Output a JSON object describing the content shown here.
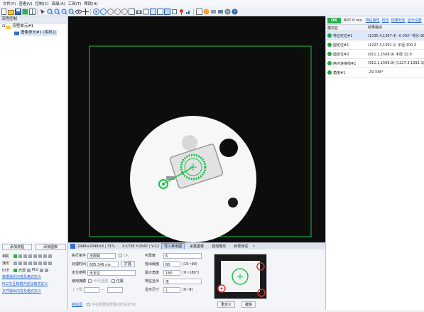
{
  "menu": [
    "文件(F)",
    "查看(V)",
    "控制(C)",
    "高级(A)",
    "工具(T)",
    "帮助(H)"
  ],
  "tree": {
    "title": "流程控制",
    "node": "流程单元#1",
    "child": "图像单元#1 (相机1)"
  },
  "left_bottom": {
    "add_flow": "添加流程",
    "add_image": "添加图像",
    "camera": "相机",
    "comm": "通讯",
    "io": "IO卡",
    "light": "光源",
    "plc": "PLC",
    "links": [
      "数据通讯内容及格式定义",
      "PLC交互数据内容及格式定义",
      "文件输出内容及格式定义"
    ]
  },
  "statusbar": {
    "size": "2448×2048×8 | 31%",
    "coords": "X:1795 Y:2047 | V:12",
    "btn1": "导入参考图",
    "btn2": "采集图像",
    "btn3": "自动曝光",
    "btn4": "目录测试"
  },
  "props": {
    "exec_label": "执行条件",
    "exec_value": "无限制",
    "ok_label": "OK",
    "time_label": "处理时间",
    "time_value": "605.349 ms",
    "expand": "扩展",
    "ref_label": "定位参照",
    "ref_value": "无定位",
    "enable_label": "使用掩膜",
    "shape": "卡尺/圆弧",
    "position": "位置",
    "upper_label": "上下限",
    "upper_dash": "—",
    "link_ref": "特征源",
    "in_range": "存在机器视觉图内时设定OK",
    "count_label": "可靠度",
    "count_value": "6",
    "thresh_label": "检出阈值",
    "thresh_value": "60",
    "thresh_range": "(15~99)",
    "angle_label": "最大角度",
    "angle_value": "180",
    "angle_range": "(0~180°)",
    "feat_label": "特征显示",
    "feat_value": "无",
    "size_label": "显示尺寸",
    "size_value": "1",
    "size_range": "(0~8)",
    "redefine": "重定义",
    "edit": "编辑"
  },
  "right": {
    "status": "OK",
    "time": "607.0 ms",
    "links": [
      "特征属性",
      "校定",
      "结果判定",
      "显示设置"
    ],
    "col1": "模块名",
    "col2": "结果描述",
    "rows": [
      {
        "name": "特征定位#1",
        "desc": "(1235.4,1387.4) -0.002° 得分:99"
      },
      {
        "name": "圆定位#1",
        "desc": "(1227.3,1391.1) 半径:100.3"
      },
      {
        "name": "圆定位#2",
        "desc": "(911.1,1568.9) 半径:32.0"
      },
      {
        "name": "两点连接线#1",
        "desc": "(911.1,1568.9)-(1227.3,1391.1)"
      },
      {
        "name": "角度#1",
        "desc": "-29.336°"
      }
    ]
  },
  "colors": {
    "accent": "#1d5fcf",
    "ok": "#24b24a",
    "roi": "#19c24a"
  }
}
